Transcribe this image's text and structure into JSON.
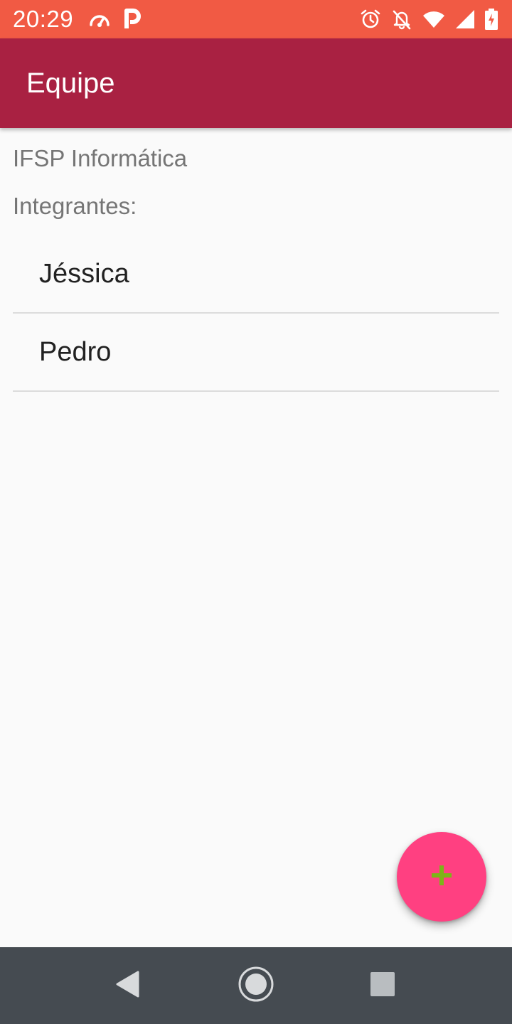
{
  "status_bar": {
    "time": "20:29",
    "left_icons": [
      "speedometer-icon",
      "parking-icon"
    ],
    "right_icons": [
      "alarm-icon",
      "notifications-off-icon",
      "wifi-icon",
      "signal-icon",
      "battery-charging-icon"
    ],
    "background": "#f15a44"
  },
  "app_bar": {
    "title": "Equipe",
    "background": "#a92142"
  },
  "team": {
    "name": "IFSP Informática",
    "members_label": "Integrantes:",
    "members": [
      "Jéssica",
      "Pedro"
    ]
  },
  "fab": {
    "icon": "plus-icon",
    "background": "#ff4081",
    "icon_color": "#7cb518"
  },
  "nav_bar": {
    "buttons": [
      "back-icon",
      "home-icon",
      "recents-icon"
    ],
    "background": "#454b51"
  }
}
